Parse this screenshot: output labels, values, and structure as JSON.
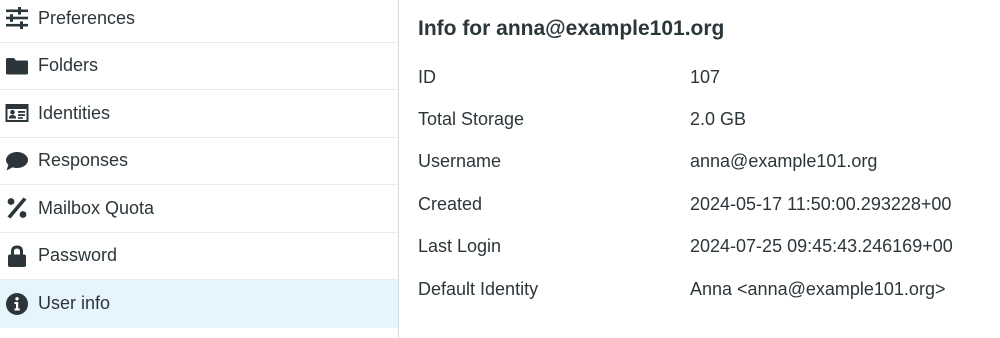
{
  "sidebar": {
    "items": [
      {
        "label": "Preferences",
        "icon": "sliders-icon",
        "active": false
      },
      {
        "label": "Folders",
        "icon": "folder-icon",
        "active": false
      },
      {
        "label": "Identities",
        "icon": "id-card-icon",
        "active": false
      },
      {
        "label": "Responses",
        "icon": "comment-icon",
        "active": false
      },
      {
        "label": "Mailbox Quota",
        "icon": "percent-icon",
        "active": false
      },
      {
        "label": "Password",
        "icon": "lock-icon",
        "active": false
      },
      {
        "label": "User info",
        "icon": "info-circle-icon",
        "active": true
      }
    ]
  },
  "main": {
    "title": "Info for anna@example101.org",
    "rows": [
      {
        "label": "ID",
        "value": "107"
      },
      {
        "label": "Total Storage",
        "value": "2.0 GB"
      },
      {
        "label": "Username",
        "value": "anna@example101.org"
      },
      {
        "label": "Created",
        "value": "2024-05-17 11:50:00.293228+00"
      },
      {
        "label": "Last Login",
        "value": "2024-07-25 09:45:43.246169+00"
      },
      {
        "label": "Default Identity",
        "value": "Anna <anna@example101.org>"
      }
    ]
  },
  "colors": {
    "text": "#2c363a",
    "active_background": "#e6f5fc",
    "divider": "#d4dbde"
  }
}
